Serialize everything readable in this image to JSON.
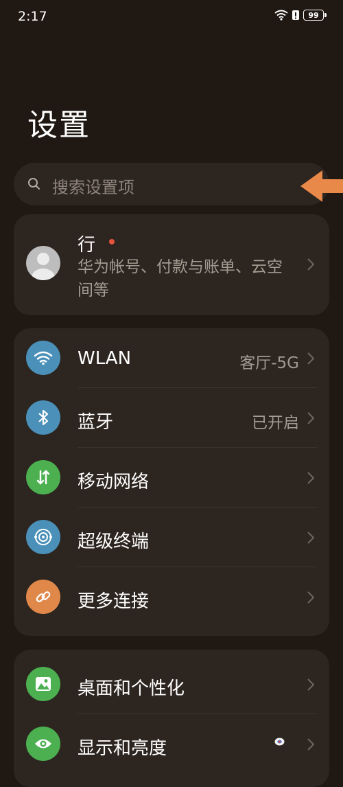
{
  "status_bar": {
    "time": "2:17",
    "battery": "99"
  },
  "page_title": "设置",
  "search": {
    "placeholder": "搜索设置项"
  },
  "profile": {
    "name": "行",
    "subtitle": "华为帐号、付款与账单、云空间等"
  },
  "connect_section": {
    "items": [
      {
        "label": "WLAN",
        "value": "客厅-5G",
        "icon": "wifi-icon",
        "color": "#4a90b8"
      },
      {
        "label": "蓝牙",
        "value": "已开启",
        "icon": "bluetooth-icon",
        "color": "#4a90b8"
      },
      {
        "label": "移动网络",
        "value": "",
        "icon": "mobile-data-icon",
        "color": "#4caf50"
      },
      {
        "label": "超级终端",
        "value": "",
        "icon": "super-device-icon",
        "color": "#4a90b8"
      },
      {
        "label": "更多连接",
        "value": "",
        "icon": "link-icon",
        "color": "#e0884a"
      }
    ]
  },
  "display_section": {
    "items": [
      {
        "label": "桌面和个性化",
        "icon": "wallpaper-icon",
        "color": "#4caf50"
      },
      {
        "label": "显示和亮度",
        "icon": "eye-icon",
        "color": "#4caf50"
      }
    ]
  },
  "colors": {
    "background": "#1f1813",
    "card": "#2d2520",
    "accent_arrow": "#e8894a"
  }
}
